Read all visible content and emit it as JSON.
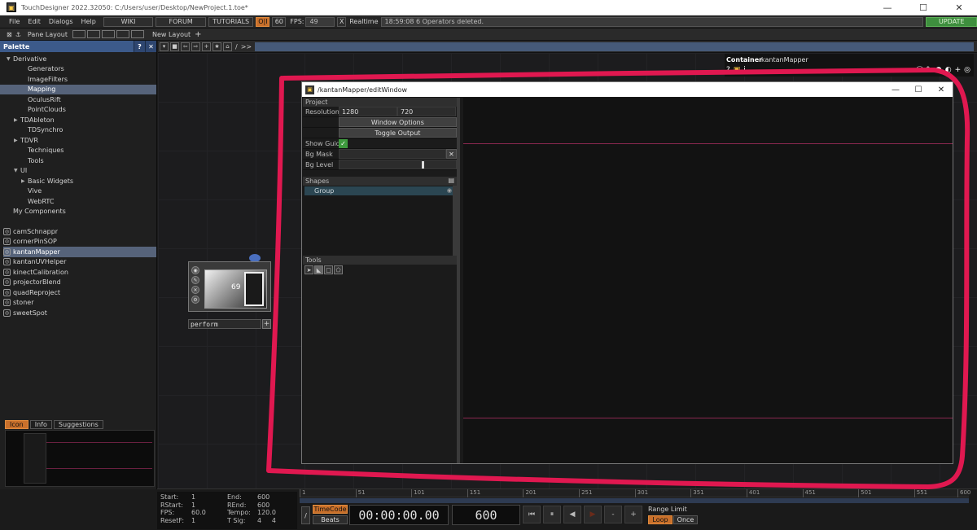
{
  "window": {
    "title": "TouchDesigner 2022.32050: C:/Users/user/Desktop/NewProject.1.toe*",
    "app_icon": "td-logo-icon"
  },
  "menubar": {
    "items": [
      "File",
      "Edit",
      "Dialogs",
      "Help"
    ],
    "wiki": "WIKI",
    "forum": "FORUM",
    "tutorials": "TUTORIALS",
    "oi": "O|I",
    "fps_set": "60",
    "fps_label": "FPS:",
    "fps_value": "49",
    "realtime_box": "X",
    "realtime_label": "Realtime",
    "status": "18:59:08 6 Operators deleted.",
    "update": "UPDATE"
  },
  "layoutbar": {
    "pane_layout": "Pane Layout",
    "new_layout": "New Layout",
    "plus": "+"
  },
  "palette": {
    "title": "Palette",
    "help": "?",
    "close": "✕",
    "tree": [
      {
        "label": "Derivative",
        "indent": 0,
        "caret": "▼",
        "selected": false
      },
      {
        "label": "Generators",
        "indent": 2,
        "caret": "",
        "selected": false
      },
      {
        "label": "ImageFilters",
        "indent": 2,
        "caret": "",
        "selected": false
      },
      {
        "label": "Mapping",
        "indent": 2,
        "caret": "",
        "selected": true
      },
      {
        "label": "OculusRift",
        "indent": 2,
        "caret": "",
        "selected": false
      },
      {
        "label": "PointClouds",
        "indent": 2,
        "caret": "",
        "selected": false
      },
      {
        "label": "TDAbleton",
        "indent": 1,
        "caret": "▶",
        "selected": false
      },
      {
        "label": "TDSynchro",
        "indent": 2,
        "caret": "",
        "selected": false
      },
      {
        "label": "TDVR",
        "indent": 1,
        "caret": "▶",
        "selected": false
      },
      {
        "label": "Techniques",
        "indent": 2,
        "caret": "",
        "selected": false
      },
      {
        "label": "Tools",
        "indent": 2,
        "caret": "",
        "selected": false
      },
      {
        "label": "UI",
        "indent": 1,
        "caret": "▼",
        "selected": false
      },
      {
        "label": "Basic Widgets",
        "indent": 2,
        "caret": "▶",
        "selected": false
      },
      {
        "label": "Vive",
        "indent": 2,
        "caret": "",
        "selected": false
      },
      {
        "label": "WebRTC",
        "indent": 2,
        "caret": "",
        "selected": false
      },
      {
        "label": "My Components",
        "indent": 0,
        "caret": "",
        "selected": false
      }
    ],
    "components": [
      {
        "label": "camSchnappr",
        "selected": false
      },
      {
        "label": "cornerPinSOP",
        "selected": false
      },
      {
        "label": "kantanMapper",
        "selected": true
      },
      {
        "label": "kantanUVHelper",
        "selected": false
      },
      {
        "label": "kinectCalibration",
        "selected": false
      },
      {
        "label": "projectorBlend",
        "selected": false
      },
      {
        "label": "quadReproject",
        "selected": false
      },
      {
        "label": "stoner",
        "selected": false
      },
      {
        "label": "sweetSpot",
        "selected": false
      }
    ],
    "tabs": [
      "Icon",
      "Info",
      "Suggestions"
    ]
  },
  "network": {
    "path": ">>",
    "node_label": "perform",
    "node_thumb_number": "69",
    "container_label": "Container",
    "container_name": "kantanMapper"
  },
  "editwin": {
    "title": "/kantanMapper/editWindow",
    "project_section": "Project",
    "resolution_label": "Resolution",
    "res_w": "1280",
    "res_h": "720",
    "window_options": "Window Options",
    "toggle_output": "Toggle Output",
    "show_guide_label": "Show Guide",
    "bg_mask_label": "Bg Mask",
    "bg_level_label": "Bg Level",
    "bg_level_value": 0.72,
    "shapes_section": "Shapes",
    "shape_item": "Group",
    "tools_section": "Tools"
  },
  "timeline": {
    "start_label": "Start:",
    "start": "1",
    "rstart_label": "RStart:",
    "rstart": "1",
    "fps_label": "FPS:",
    "fps": "60.0",
    "resetf_label": "ResetF:",
    "resetf": "1",
    "end_label": "End:",
    "end": "600",
    "rend_label": "REnd:",
    "rend": "600",
    "tempo_label": "Tempo:",
    "tempo": "120.0",
    "tsig_label": "T Sig:",
    "tsig_a": "4",
    "tsig_b": "4",
    "ticks": [
      "1",
      "51",
      "101",
      "151",
      "201",
      "251",
      "301",
      "351",
      "401",
      "451",
      "501",
      "551",
      "600"
    ],
    "timecode": "TimeCode",
    "beats": "Beats",
    "time": "00:00:00.00",
    "frame": "600",
    "range_limit": "Range Limit",
    "loop": "Loop",
    "once": "Once"
  }
}
